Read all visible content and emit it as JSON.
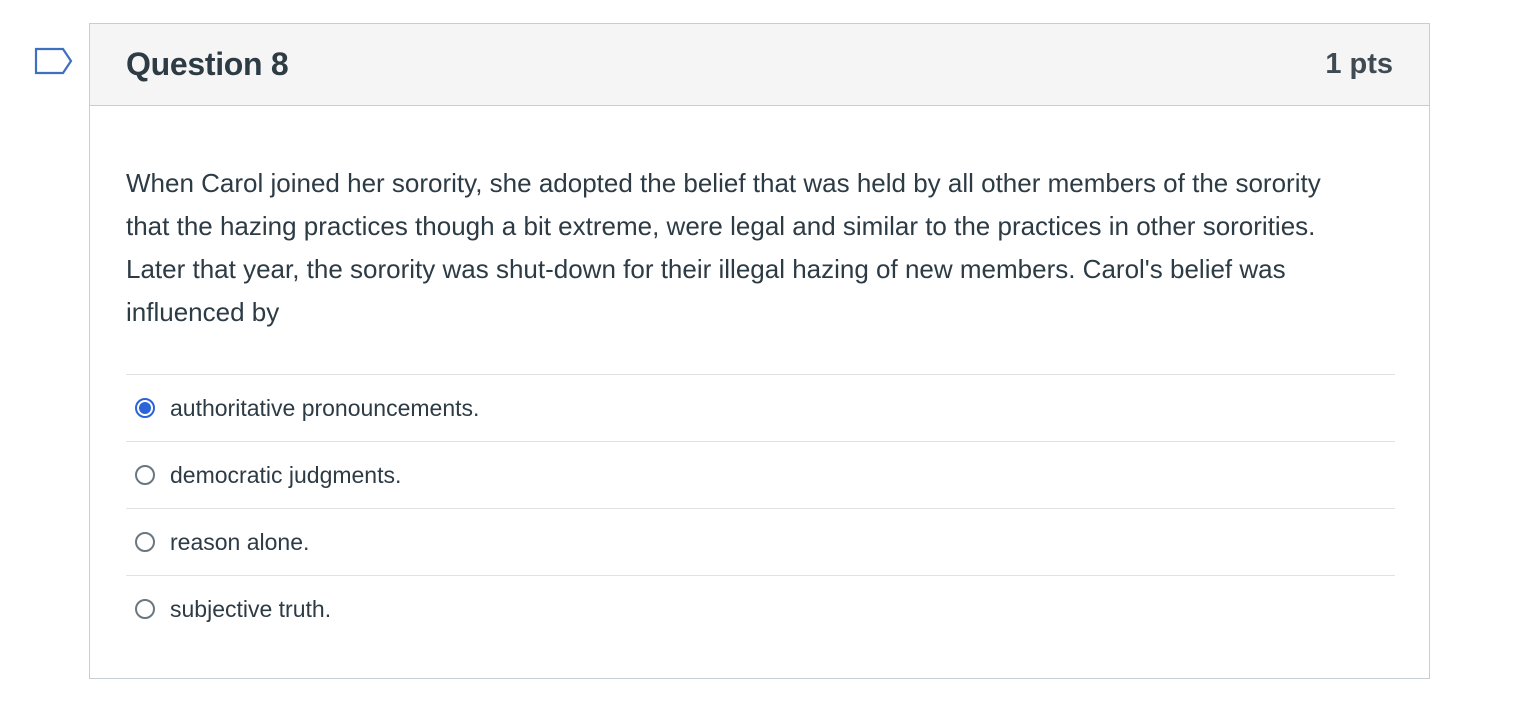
{
  "question": {
    "title": "Question 8",
    "points": "1 pts",
    "text": "When Carol joined her sorority, she adopted the belief that was held by all other members of the sorority that the hazing practices though a bit extreme, were legal and similar to the practices in other sororities.  Later that year, the sorority was shut-down for their illegal hazing of new members. Carol's belief was influenced by",
    "selected_index": 0,
    "answers": [
      {
        "label": "authoritative pronouncements.",
        "selected": true
      },
      {
        "label": "democratic judgments.",
        "selected": false
      },
      {
        "label": "reason alone.",
        "selected": false
      },
      {
        "label": "subjective truth.",
        "selected": false
      }
    ]
  },
  "icons": {
    "flag": "flag-question-icon"
  },
  "colors": {
    "accent": "#2b64d9",
    "header_bg": "#f5f5f5",
    "border": "#c7cdd1",
    "text": "#2d3b45"
  }
}
